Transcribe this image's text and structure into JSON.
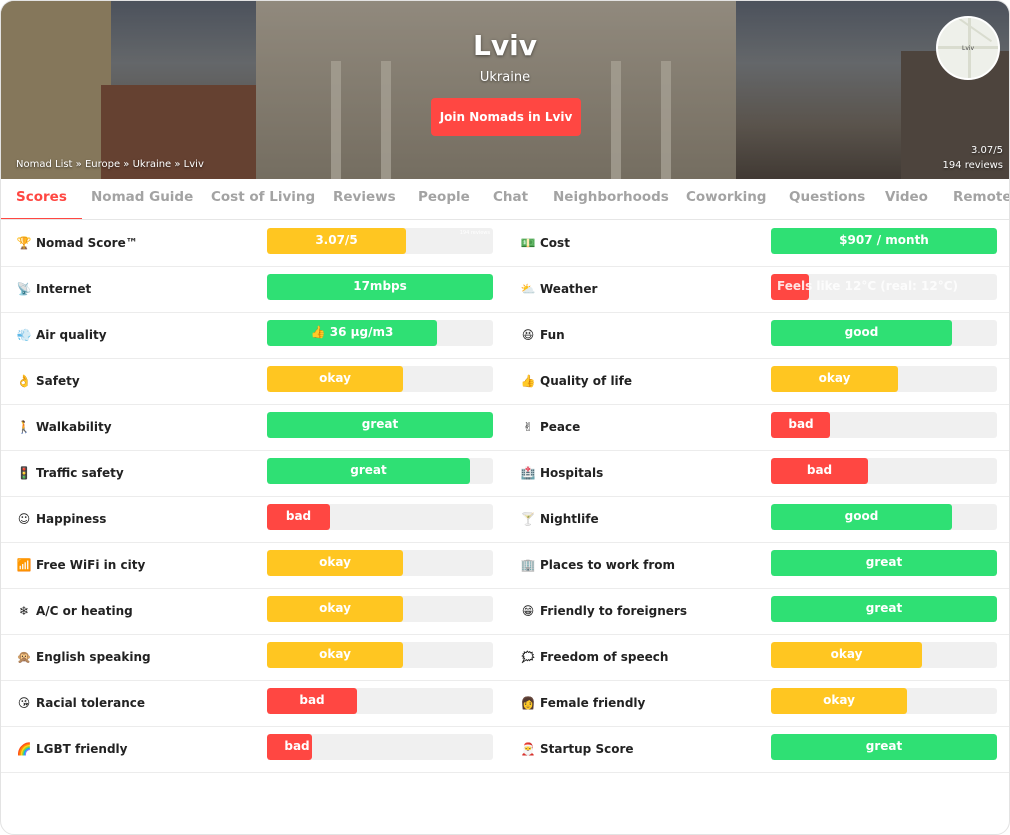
{
  "hero": {
    "city": "Lviv",
    "country": "Ukraine",
    "join_label": "Join Nomads in Lviv",
    "breadcrumb": "Nomad List » Europe » Ukraine » Lviv",
    "rating": "3.07/5",
    "reviews": "194 reviews",
    "map_label": "Lviv"
  },
  "tabs": [
    "Scores",
    "Nomad Guide",
    "Cost of Living",
    "Reviews",
    "People",
    "Chat",
    "Neighborhoods",
    "Coworking",
    "Questions",
    "Video",
    "Remote"
  ],
  "colors": {
    "green": "#2fe074",
    "yellow": "#ffc621",
    "red": "#ff4742",
    "track": "#f0f0f0"
  },
  "scores_left": [
    {
      "icon": "trophy-icon",
      "label": "Nomad Score™",
      "value": "3.07/5",
      "color": "yellow",
      "level": 0.614,
      "extra": "194 reviews"
    },
    {
      "icon": "antenna-icon",
      "label": "Internet",
      "value": "17mbps",
      "color": "green",
      "level": 1.0
    },
    {
      "icon": "wind-icon",
      "label": "Air quality",
      "value": "👍 36 µg/m3",
      "color": "green",
      "level": 0.75
    },
    {
      "icon": "ok-hand-icon",
      "label": "Safety",
      "value": "okay",
      "color": "yellow",
      "level": 0.6
    },
    {
      "icon": "walking-person-icon",
      "label": "Walkability",
      "value": "great",
      "color": "green",
      "level": 1.0
    },
    {
      "icon": "traffic-light-icon",
      "label": "Traffic safety",
      "value": "great",
      "color": "green",
      "level": 0.9
    },
    {
      "icon": "smile-icon",
      "label": "Happiness",
      "value": "bad",
      "color": "red",
      "level": 0.28
    },
    {
      "icon": "wifi-icon",
      "label": "Free WiFi in city",
      "value": "okay",
      "color": "yellow",
      "level": 0.6
    },
    {
      "icon": "snowflake-icon",
      "label": "A/C or heating",
      "value": "okay",
      "color": "yellow",
      "level": 0.6
    },
    {
      "icon": "monkey-icon",
      "label": "English speaking",
      "value": "okay",
      "color": "yellow",
      "level": 0.6
    },
    {
      "icon": "kiss-face-icon",
      "label": "Racial tolerance",
      "value": "bad",
      "color": "red",
      "level": 0.4
    },
    {
      "icon": "rainbow-icon",
      "label": "LGBT friendly",
      "value": "bad",
      "color": "red",
      "level": 0.2
    }
  ],
  "scores_right": [
    {
      "icon": "money-icon",
      "label": "Cost",
      "value": "$907 / month",
      "color": "green",
      "level": 1.0
    },
    {
      "icon": "cloud-sun-icon",
      "label": "Weather",
      "value": "Feels like 12°C (real: 12°C)",
      "color": "red",
      "level": 0.17
    },
    {
      "icon": "laughing-face-icon",
      "label": "Fun",
      "value": "good",
      "color": "green",
      "level": 0.8
    },
    {
      "icon": "thumbs-up-icon",
      "label": "Quality of life",
      "value": "okay",
      "color": "yellow",
      "level": 0.56
    },
    {
      "icon": "peace-hand-icon",
      "label": "Peace",
      "value": "bad",
      "color": "red",
      "level": 0.26
    },
    {
      "icon": "hospital-icon",
      "label": "Hospitals",
      "value": "bad",
      "color": "red",
      "level": 0.43
    },
    {
      "icon": "cocktail-icon",
      "label": "Nightlife",
      "value": "good",
      "color": "green",
      "level": 0.8
    },
    {
      "icon": "office-icon",
      "label": "Places to work from",
      "value": "great",
      "color": "green",
      "level": 1.0
    },
    {
      "icon": "grin-icon",
      "label": "Friendly to foreigners",
      "value": "great",
      "color": "green",
      "level": 1.0
    },
    {
      "icon": "speech-icon",
      "label": "Freedom of speech",
      "value": "okay",
      "color": "yellow",
      "level": 0.67
    },
    {
      "icon": "woman-icon",
      "label": "Female friendly",
      "value": "okay",
      "color": "yellow",
      "level": 0.6
    },
    {
      "icon": "santa-icon",
      "label": "Startup Score",
      "value": "great",
      "color": "green",
      "level": 1.0
    }
  ]
}
